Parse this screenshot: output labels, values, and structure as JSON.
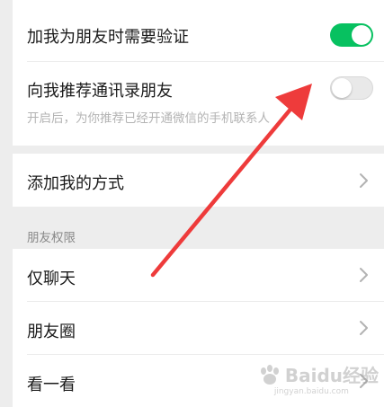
{
  "settings": {
    "verify_when_adding": {
      "label": "加我为朋友时需要验证",
      "enabled": true
    },
    "recommend_contacts": {
      "label": "向我推荐通讯录朋友",
      "description": "开启后，为你推荐已经开通微信的手机联系人",
      "enabled": false
    },
    "add_methods": {
      "label": "添加我的方式"
    }
  },
  "friend_permissions": {
    "header": "朋友权限",
    "items": [
      {
        "label": "仅聊天"
      },
      {
        "label": "朋友圈"
      },
      {
        "label": "看一看"
      }
    ]
  },
  "watermark": {
    "text": "Baidu经验",
    "url_text": "jingyan.baidu.com"
  },
  "colors": {
    "toggle_on": "#07c160",
    "annotation_arrow": "#ee3b3b"
  },
  "icons": {
    "row_chevron": "chevron-right-icon",
    "annotation": "red-arrow-icon"
  }
}
